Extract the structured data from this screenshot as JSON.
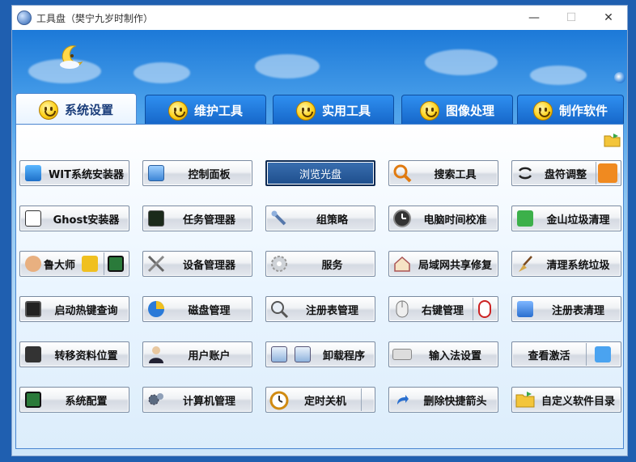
{
  "window": {
    "title": "工具盘（樊宁九岁时制作）"
  },
  "tabs": [
    {
      "label": "系统设置",
      "active": true
    },
    {
      "label": "维护工具",
      "active": false
    },
    {
      "label": "实用工具",
      "active": false
    },
    {
      "label": "图像处理",
      "active": false
    },
    {
      "label": "制作软件",
      "active": false
    }
  ],
  "buttons": {
    "r1": [
      "WIT系统安装器",
      "控制面板",
      "浏览光盘",
      "搜索工具",
      "盘符调整"
    ],
    "r2": [
      "Ghost安装器",
      "任务管理器",
      "组策略",
      "电脑时间校准",
      "金山垃圾清理"
    ],
    "r3": [
      "鲁大师",
      "设备管理器",
      "服务",
      "局域网共享修复",
      "清理系统垃圾"
    ],
    "r4": [
      "启动热键查询",
      "磁盘管理",
      "注册表管理",
      "右键管理",
      "注册表清理"
    ],
    "r5": [
      "转移资料位置",
      "用户账户",
      "卸载程序",
      "输入法设置",
      "查看激活"
    ],
    "r6": [
      "系统配置",
      "计算机管理",
      "定时关机",
      "删除快捷箭头",
      "自定义软件目录"
    ]
  },
  "colors": {
    "tab_blue": "#1a6fd8",
    "active_tab": "#ffffff",
    "panel": "#e6f2fd"
  }
}
